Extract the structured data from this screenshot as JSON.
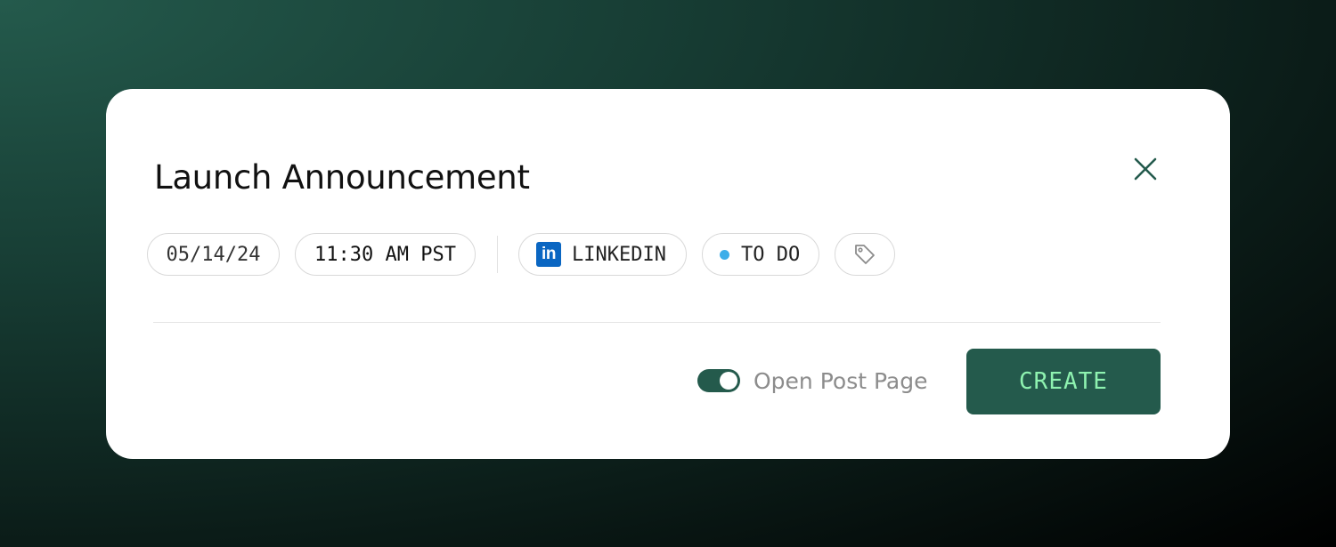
{
  "modal": {
    "title": "Launch Announcement",
    "close_icon": "close-icon"
  },
  "meta": {
    "date": "05/14/24",
    "time": "11:30 AM PST",
    "platform": {
      "icon": "linkedin-icon",
      "icon_text": "in",
      "label": "LINKEDIN",
      "brand_color": "#0a66c2"
    },
    "status": {
      "label": "TO DO",
      "dot_color": "#3daee9"
    },
    "tag_icon": "tag-icon"
  },
  "footer": {
    "toggle_label": "Open Post Page",
    "toggle_on": true,
    "create_label": "CREATE"
  },
  "colors": {
    "accent": "#245a4c",
    "button_text": "#8ef2b0"
  }
}
